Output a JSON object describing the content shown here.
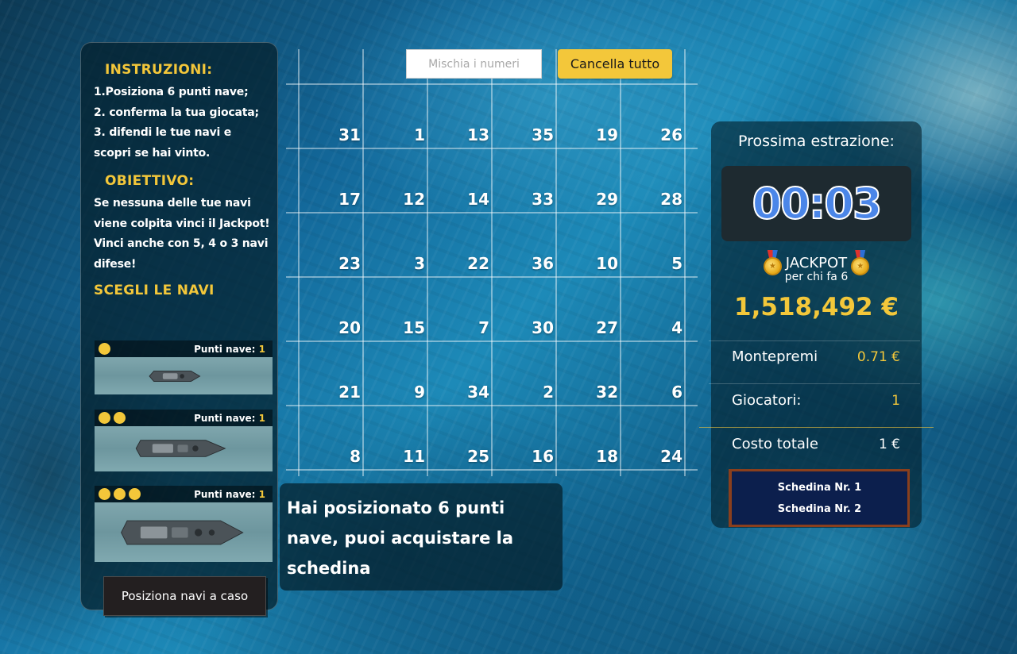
{
  "instructions": {
    "title": "INSTRUZIONI:",
    "text": "1.Posiziona 6 punti nave;\n2. conferma la tua giocata;\n3. difendi le tue navi e scopri se hai vinto."
  },
  "objective": {
    "title": "OBIETTIVO:",
    "text": "Se nessuna delle tue navi viene colpita vinci il Jackpot!\nVinci anche con 5, 4 o 3 navi difese!"
  },
  "ships": {
    "title": "SCEGLI LE NAVI",
    "points_label": "Punti nave:",
    "items": [
      {
        "size": 1,
        "points": "1",
        "icon": "small-ship-icon"
      },
      {
        "size": 2,
        "points": "1",
        "icon": "medium-ship-icon"
      },
      {
        "size": 3,
        "points": "1",
        "icon": "large-ship-icon"
      }
    ],
    "random_button": "Posiziona navi a caso"
  },
  "grid": {
    "shuffle_placeholder": "Mischia i numeri",
    "clear_button": "Cancella tutto",
    "rows": [
      [
        "31",
        "1",
        "13",
        "35",
        "19",
        "26"
      ],
      [
        "17",
        "12",
        "14",
        "33",
        "29",
        "28"
      ],
      [
        "23",
        "3",
        "22",
        "36",
        "10",
        "5"
      ],
      [
        "20",
        "15",
        "7",
        "30",
        "27",
        "4"
      ],
      [
        "21",
        "9",
        "34",
        "2",
        "32",
        "6"
      ],
      [
        "8",
        "11",
        "25",
        "16",
        "18",
        "24"
      ]
    ]
  },
  "message": "Hai posizionato 6 punti nave, puoi acquistare la schedina",
  "draw": {
    "title": "Prossima estrazione:",
    "timer": "00:03",
    "jackpot_label": "JACKPOT",
    "jackpot_sub": "per chi fa 6",
    "jackpot_amount": "1,518,492 €",
    "prize_pool_label": "Montepremi",
    "prize_pool_value": "0.71 €",
    "players_label": "Giocatori:",
    "players_value": "1",
    "total_cost_label": "Costo totale",
    "total_cost_value": "1 €",
    "tickets": [
      "Schedina Nr. 1",
      "Schedina Nr. 2"
    ]
  },
  "colors": {
    "accent": "#f3c73a",
    "timer": "#4b86e8",
    "ticket_bg": "#0c1f4d",
    "ticket_border": "#8a3f1d"
  }
}
